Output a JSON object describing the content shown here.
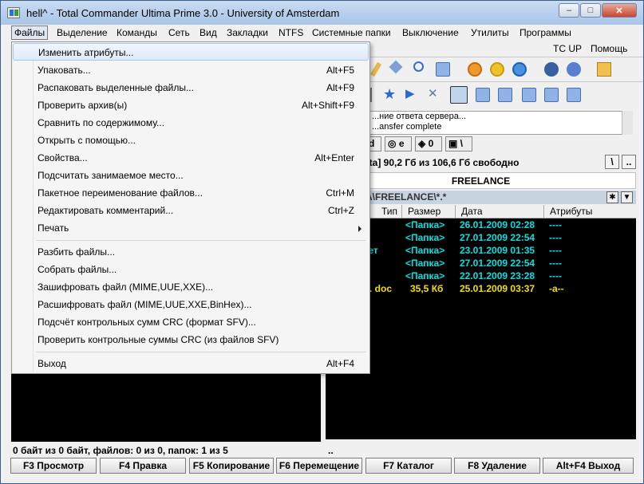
{
  "window": {
    "title": "hell^ - Total Commander Ultima Prime 3.0 - University of Amsterdam"
  },
  "menubar": [
    "Файлы",
    "Выделение",
    "Команды",
    "Сеть",
    "Вид",
    "Закладки",
    "NTFS",
    "Системные папки",
    "Выключение",
    "Утилиты",
    "Программы"
  ],
  "toolrow2": {
    "tcup": "TC UP",
    "help": "Помощь"
  },
  "ftp_log": [
    "...ние ответа сервера...",
    "...ansfer complete"
  ],
  "drive_buttons": [
    "d",
    "e",
    "0",
    "\\"
  ],
  "free_space": "ata]  90,2 Гб из 106,6 Гб свободно",
  "panel": {
    "title": "FREELANCE",
    "path": "A\\FREELANCE\\*.*",
    "columns": {
      "type": "Тип",
      "size": "Размер",
      "date": "Дата",
      "attrs": "Атрибуты"
    },
    "rows": [
      {
        "name": "",
        "size": "<Папка>",
        "date": "26.01.2009 02:28",
        "attrs": "----",
        "color": "#00e0e0"
      },
      {
        "name": "",
        "size": "<Папка>",
        "date": "27.01.2009 22:54",
        "attrs": "----",
        "color": "#00e0e0"
      },
      {
        "name": "иет",
        "size": "<Папка>",
        "date": "23.01.2009 01:35",
        "attrs": "----",
        "color": "#00e0e0"
      },
      {
        "name": "",
        "size": "<Папка>",
        "date": "27.01.2009 22:54",
        "attrs": "----",
        "color": "#00e0e0"
      },
      {
        "name": "",
        "size": "<Папка>",
        "date": "22.01.2009 23:28",
        "attrs": "----",
        "color": "#00e0e0"
      },
      {
        "name": ". doc",
        "size": "35,5 Кб",
        "date": "25.01.2009 03:37",
        "attrs": "-a--",
        "color": "#f0e000"
      }
    ]
  },
  "status": {
    "left": "0 байт из 0 байт, файлов: 0 из 0, папок: 1 из 5",
    "right": ".."
  },
  "fkeys": [
    "F3 Просмотр",
    "F4 Правка",
    "F5 Копирование",
    "F6 Перемещение",
    "F7 Каталог",
    "F8 Удаление",
    "Alt+F4 Выход"
  ],
  "dropdown": {
    "items": [
      {
        "label": "Изменить атрибуты...",
        "shortcut": ""
      },
      {
        "label": "Упаковать...",
        "shortcut": "Alt+F5"
      },
      {
        "label": "Распаковать выделенные файлы...",
        "shortcut": "Alt+F9"
      },
      {
        "label": "Проверить архив(ы)",
        "shortcut": "Alt+Shift+F9"
      },
      {
        "label": "Сравнить по содержимому...",
        "shortcut": ""
      },
      {
        "label": "Открыть с помощью...",
        "shortcut": ""
      },
      {
        "label": "Свойства...",
        "shortcut": "Alt+Enter"
      },
      {
        "label": "Подсчитать занимаемое место...",
        "shortcut": ""
      },
      {
        "label": "Пакетное переименование файлов...",
        "shortcut": "Ctrl+M"
      },
      {
        "label": "Редактировать комментарий...",
        "shortcut": "Ctrl+Z"
      },
      {
        "label": "Печать",
        "shortcut": ""
      },
      {
        "label": "Разбить файлы...",
        "shortcut": ""
      },
      {
        "label": "Собрать файлы...",
        "shortcut": ""
      },
      {
        "label": "Зашифровать файл (MIME,UUE,XXE)...",
        "shortcut": ""
      },
      {
        "label": "Расшифровать файл (MIME,UUE,XXE,BinHex)...",
        "shortcut": ""
      },
      {
        "label": "Подсчёт контрольных сумм CRC (формат SFV)...",
        "shortcut": ""
      },
      {
        "label": "Проверить контрольные суммы CRC (из файлов SFV)",
        "shortcut": ""
      },
      {
        "label": "Выход",
        "shortcut": "Alt+F4"
      }
    ]
  }
}
